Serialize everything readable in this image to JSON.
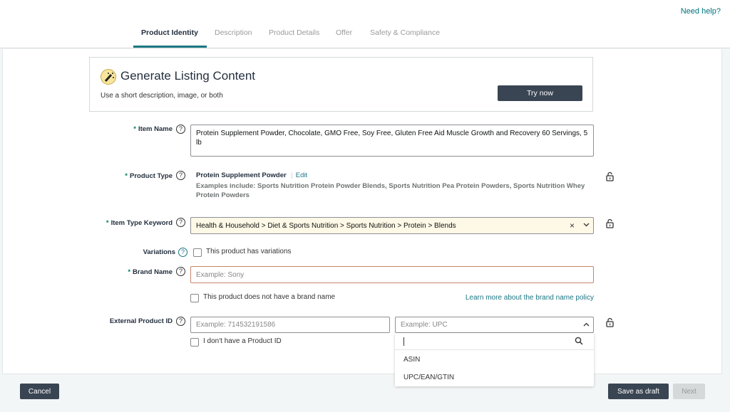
{
  "header": {
    "help_link": "Need help?",
    "tabs": [
      {
        "label": "Product Identity",
        "active": true
      },
      {
        "label": "Description"
      },
      {
        "label": "Product Details"
      },
      {
        "label": "Offer"
      },
      {
        "label": "Safety & Compliance"
      }
    ]
  },
  "generate": {
    "icon": "magic-wand-icon",
    "title": "Generate Listing Content",
    "subtitle": "Use a short description, image, or both",
    "button": "Try now"
  },
  "form": {
    "required_mark": "*",
    "item_name": {
      "label": "Item Name",
      "value": "Protein Supplement Powder, Chocolate, GMO Free, Soy Free, Gluten Free Aid Muscle Growth and Recovery 60 Servings, 5 lb"
    },
    "product_type": {
      "label": "Product Type",
      "value": "Protein Supplement Powder",
      "separator": "|",
      "edit": "Edit",
      "examples": "Examples include: Sports Nutrition Protein Powder Blends, Sports Nutrition Pea Protein Powders, Sports Nutrition Whey Protein Powders"
    },
    "item_type_keyword": {
      "label": "Item Type Keyword",
      "value": "Health & Household > Diet & Sports Nutrition > Sports Nutrition > Protein > Blends",
      "clear": "×"
    },
    "variations": {
      "label": "Variations",
      "checkbox": "This product has variations"
    },
    "brand_name": {
      "label": "Brand Name",
      "placeholder": "Example: Sony",
      "checkbox": "This product does not have a brand name",
      "policy_link": "Learn more about the brand name policy"
    },
    "external_id": {
      "label": "External Product ID",
      "placeholder": "Example: 714532191586",
      "type_placeholder": "Example: UPC",
      "checkbox": "I don't have a Product ID",
      "options": [
        "ASIN",
        "UPC/EAN/GTIN"
      ]
    }
  },
  "footer": {
    "cancel": "Cancel",
    "save": "Save as draft",
    "next": "Next"
  },
  "colors": {
    "accent": "#1b7784",
    "button": "#3a4553",
    "keyword_bg": "#fef8e6",
    "brand_border": "#c7866a"
  }
}
